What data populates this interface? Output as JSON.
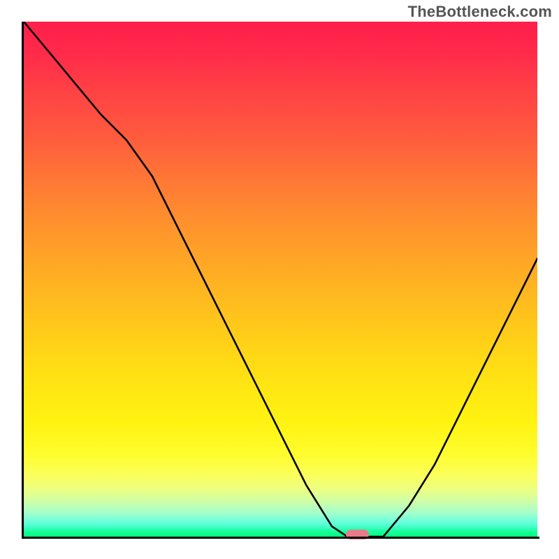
{
  "watermark": "TheBottleneck.com",
  "marker_color": "#e87b8a",
  "chart_data": {
    "type": "line",
    "title": "",
    "xlabel": "",
    "ylabel": "",
    "xlim": [
      0,
      100
    ],
    "ylim": [
      0,
      100
    ],
    "x": [
      0,
      5,
      10,
      15,
      20,
      25,
      30,
      35,
      40,
      45,
      50,
      55,
      60,
      63,
      66,
      70,
      75,
      80,
      85,
      90,
      95,
      100
    ],
    "y": [
      100,
      94,
      88,
      82,
      77,
      70,
      60,
      50,
      40,
      30,
      20,
      10,
      2,
      0,
      0,
      0,
      6,
      14,
      24,
      34,
      44,
      54
    ],
    "marker": {
      "x": 65,
      "y": 0,
      "width_pct": 4.5
    },
    "gradient_stops": [
      {
        "pct": 0,
        "color": "#ff1f4b"
      },
      {
        "pct": 50,
        "color": "#ffbb1f"
      },
      {
        "pct": 85,
        "color": "#fffd2e"
      },
      {
        "pct": 100,
        "color": "#00ff7a"
      }
    ]
  }
}
